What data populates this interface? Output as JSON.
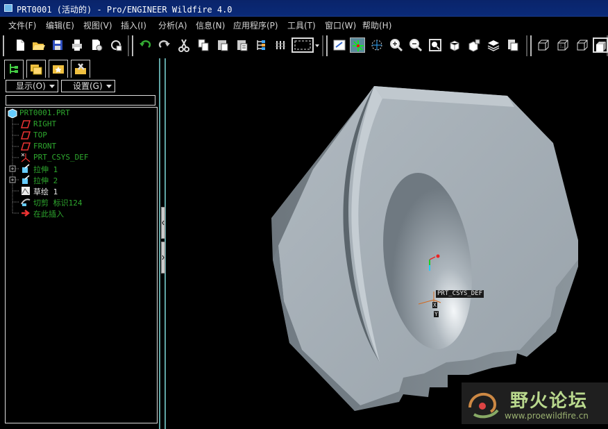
{
  "window": {
    "title": "PRT0001 (活动的) - Pro/ENGINEER Wildfire 4.0"
  },
  "menu": [
    {
      "label": "文件(F)"
    },
    {
      "label": "编辑(E)"
    },
    {
      "label": "视图(V)"
    },
    {
      "label": "插入(I)"
    },
    {
      "label": "分析(A)"
    },
    {
      "label": "信息(N)"
    },
    {
      "label": "应用程序(P)"
    },
    {
      "label": "工具(T)"
    },
    {
      "label": "窗口(W)"
    },
    {
      "label": "帮助(H)"
    }
  ],
  "toolbar": {
    "icons": [
      "new-file-icon",
      "open-file-icon",
      "save-icon",
      "print-icon",
      "send-mail-icon",
      "regenerate-icon",
      "undo-icon",
      "redo-icon",
      "cut-icon",
      "copy-icon",
      "paste-icon",
      "paste-special-icon",
      "regen-manager-icon",
      "model-tree-layers-icon",
      "selection-filter-icon",
      "repaint-icon",
      "spin-center-icon",
      "orient-mode-icon",
      "zoom-in-icon",
      "zoom-out-icon",
      "refit-icon",
      "reorient-icon",
      "saved-views-icon",
      "layers-icon",
      "view-manager-icon",
      "wireframe-icon",
      "hidden-line-icon",
      "no-hidden-icon",
      "shading-icon"
    ]
  },
  "panel": {
    "tabs": [
      "model-tree-tab",
      "folder-browser-tab",
      "favorites-tab",
      "connections-tab"
    ],
    "show_label": "显示(O)",
    "settings_label": "设置(G)",
    "tree": [
      {
        "label": "PRT0001.PRT",
        "icon": "part-icon"
      },
      {
        "label": "RIGHT",
        "icon": "datum-plane-icon"
      },
      {
        "label": "TOP",
        "icon": "datum-plane-icon"
      },
      {
        "label": "FRONT",
        "icon": "datum-plane-icon"
      },
      {
        "label": "PRT_CSYS_DEF",
        "icon": "csys-icon"
      },
      {
        "label": "拉伸 1",
        "icon": "extrude-icon"
      },
      {
        "label": "拉伸 2",
        "icon": "extrude-icon"
      },
      {
        "label": "草绘 1",
        "icon": "sketch-icon"
      },
      {
        "label": "切剪 标识124",
        "icon": "cut-icon"
      },
      {
        "label": "在此插入",
        "icon": "insert-here-arrow-icon"
      }
    ]
  },
  "viewport": {
    "csys_label": "PRT_CSYS_DEF",
    "axis_x": "X",
    "axis_y": "Y",
    "model_color": "#a3acb3"
  },
  "watermark": {
    "text": "野火论坛",
    "url": "www.proewildfire.cn"
  }
}
